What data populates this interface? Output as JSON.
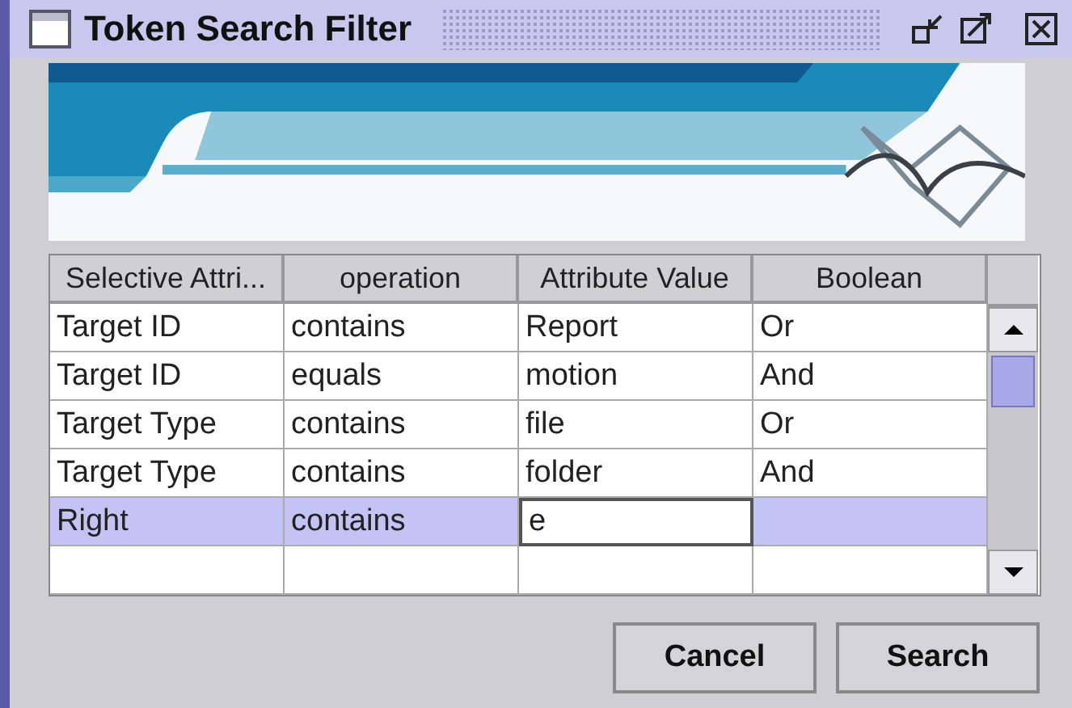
{
  "window": {
    "title": "Token Search Filter"
  },
  "table": {
    "columns": [
      "Selective Attri...",
      "operation",
      "Attribute Value",
      "Boolean"
    ],
    "rows": [
      {
        "selected": false,
        "cells": [
          {
            "text": "Target ID",
            "editing": false
          },
          {
            "text": "contains",
            "editing": false
          },
          {
            "text": "Report",
            "editing": false
          },
          {
            "text": "Or",
            "editing": false
          }
        ]
      },
      {
        "selected": false,
        "cells": [
          {
            "text": "Target ID",
            "editing": false
          },
          {
            "text": "equals",
            "editing": false
          },
          {
            "text": "motion",
            "editing": false
          },
          {
            "text": "And",
            "editing": false
          }
        ]
      },
      {
        "selected": false,
        "cells": [
          {
            "text": "Target Type",
            "editing": false
          },
          {
            "text": "contains",
            "editing": false
          },
          {
            "text": "file",
            "editing": false
          },
          {
            "text": "Or",
            "editing": false
          }
        ]
      },
      {
        "selected": false,
        "cells": [
          {
            "text": "Target Type",
            "editing": false
          },
          {
            "text": "contains",
            "editing": false
          },
          {
            "text": "folder",
            "editing": false
          },
          {
            "text": "And",
            "editing": false
          }
        ]
      },
      {
        "selected": true,
        "cells": [
          {
            "text": "Right",
            "editing": false
          },
          {
            "text": "contains",
            "editing": false
          },
          {
            "text": "e",
            "editing": true
          },
          {
            "editing": false
          }
        ]
      }
    ]
  },
  "buttons": [
    "Cancel",
    "Search"
  ]
}
